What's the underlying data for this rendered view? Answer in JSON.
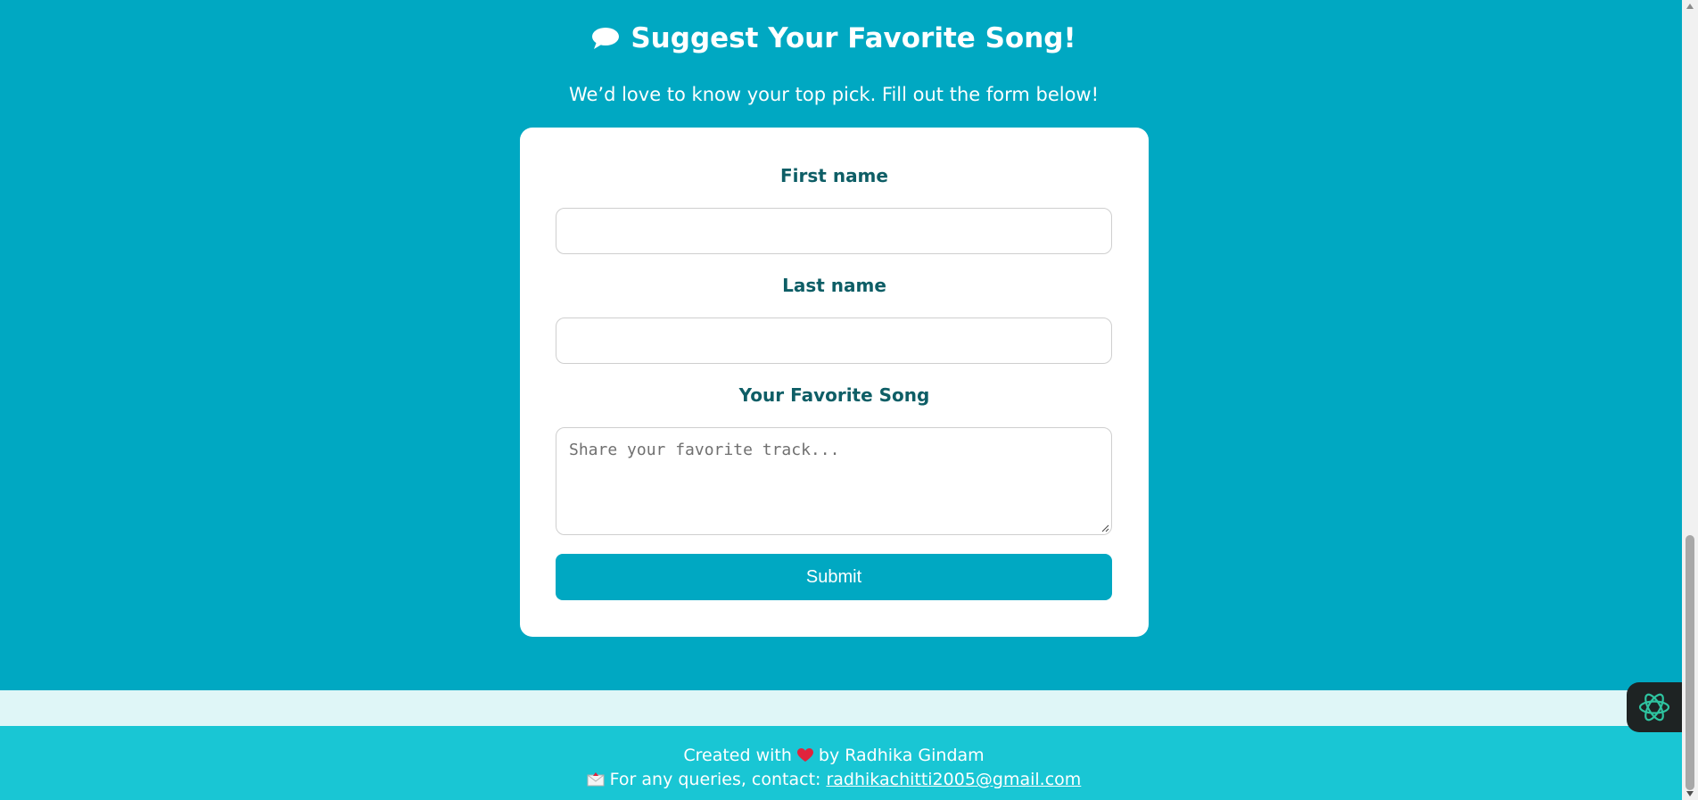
{
  "colors": {
    "background": "#00a8c2",
    "card": "#ffffff",
    "label": "#0e5e66",
    "button": "#00a8c2",
    "band": "#dff6f7",
    "footer": "#19c6d4"
  },
  "header": {
    "icon": "speech-bubble-icon",
    "title": "Suggest Your Favorite Song!",
    "subtitle": "We’d love to know your top pick. Fill out the form below!"
  },
  "form": {
    "first_name_label": "First name",
    "first_name_value": "",
    "last_name_label": "Last name",
    "last_name_value": "",
    "song_label": "Your Favorite Song",
    "song_placeholder": "Share your favorite track...",
    "submit_label": "Submit"
  },
  "footer": {
    "created_prefix": "Created with",
    "heart_icon": "heart-icon",
    "created_suffix": "by Radhika Gindam",
    "mail_icon": "envelope-icon",
    "contact_prefix": "For any queries, contact:",
    "email": "radhikachitti2005@gmail.com"
  },
  "assistant": {
    "icon": "ai-assistant-icon"
  }
}
